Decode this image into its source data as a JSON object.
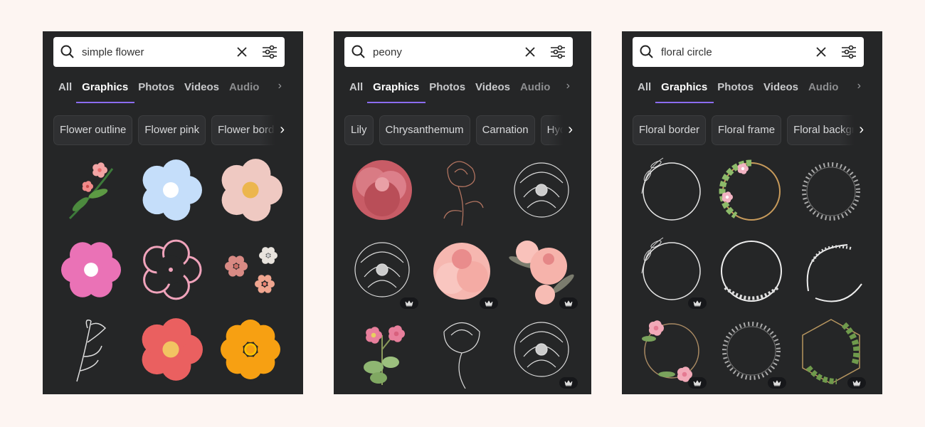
{
  "colors": {
    "page_bg": "#fdf5f2",
    "panel_bg": "#252627",
    "tab_underline": "#8b6cf0"
  },
  "panels": [
    {
      "query": "simple flower",
      "tabs": [
        "All",
        "Graphics",
        "Photos",
        "Videos",
        "Audio"
      ],
      "active_tab": "Graphics",
      "chips": [
        "Flower outline",
        "Flower pink",
        "Flower border"
      ],
      "items": [
        {
          "kind": "sprig",
          "premium": false
        },
        {
          "kind": "blue-flower",
          "premium": false
        },
        {
          "kind": "beige-flower",
          "premium": false
        },
        {
          "kind": "pink-flower",
          "premium": false
        },
        {
          "kind": "outline-pink",
          "premium": false
        },
        {
          "kind": "small-flowers",
          "premium": false
        },
        {
          "kind": "line-stem",
          "premium": false
        },
        {
          "kind": "red-flower",
          "premium": false
        },
        {
          "kind": "orange-flower",
          "premium": false
        }
      ]
    },
    {
      "query": "peony",
      "tabs": [
        "All",
        "Graphics",
        "Photos",
        "Videos",
        "Audio"
      ],
      "active_tab": "Graphics",
      "chips": [
        "Lily",
        "Chrysanthemum",
        "Carnation",
        "Hydrangea"
      ],
      "items": [
        {
          "kind": "red-peony",
          "premium": false
        },
        {
          "kind": "copper-line",
          "premium": false
        },
        {
          "kind": "white-line",
          "premium": false
        },
        {
          "kind": "white-line",
          "premium": true
        },
        {
          "kind": "pink-peony",
          "premium": true
        },
        {
          "kind": "pink-bunch",
          "premium": true
        },
        {
          "kind": "rose-branch",
          "premium": false
        },
        {
          "kind": "white-line-stem",
          "premium": false
        },
        {
          "kind": "white-line",
          "premium": true
        }
      ]
    },
    {
      "query": "floral circle",
      "tabs": [
        "All",
        "Graphics",
        "Photos",
        "Videos",
        "Audio"
      ],
      "active_tab": "Graphics",
      "chips": [
        "Floral border",
        "Floral frame",
        "Floral background"
      ],
      "items": [
        {
          "kind": "ring-leaf",
          "premium": false
        },
        {
          "kind": "ring-gold",
          "premium": false
        },
        {
          "kind": "ring-wreath",
          "premium": false
        },
        {
          "kind": "ring-leaf",
          "premium": true
        },
        {
          "kind": "ring-white",
          "premium": false
        },
        {
          "kind": "ring-swirl",
          "premium": false
        },
        {
          "kind": "ring-pink",
          "premium": true
        },
        {
          "kind": "ring-wreath",
          "premium": true
        },
        {
          "kind": "ring-hex",
          "premium": true
        }
      ]
    }
  ]
}
